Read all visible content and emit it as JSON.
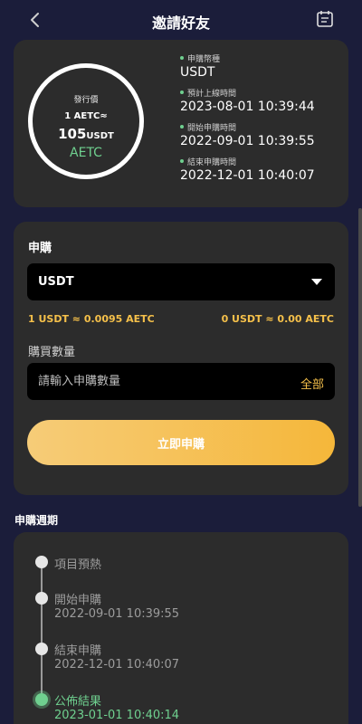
{
  "header": {
    "title": "邀請好友",
    "back_icon": "back-arrow-icon",
    "calendar_icon": "calendar-icon"
  },
  "price_card": {
    "ring_label": "發行價",
    "ring_line1": "1 AETC≈",
    "ring_value": "105",
    "ring_unit": "USDT",
    "ring_token": "AETC",
    "items": [
      {
        "label": "申購幣種",
        "value": "USDT"
      },
      {
        "label": "預計上線時間",
        "value": "2023-08-01 10:39:44"
      },
      {
        "label": "開始申購時間",
        "value": "2022-09-01 10:39:55"
      },
      {
        "label": "結束申購時間",
        "value": "2022-12-01 10:40:07"
      }
    ]
  },
  "subscribe": {
    "title": "申購",
    "currency_selected": "USDT",
    "rate_left": "1 USDT ≈ 0.0095 AETC",
    "rate_right": "0 USDT ≈ 0.00 AETC",
    "qty_label": "購買數量",
    "qty_placeholder": "請輸入申購數量",
    "qty_value": "",
    "all_label": "全部",
    "buy_label": "立即申購"
  },
  "period": {
    "title": "申購週期",
    "steps": [
      {
        "name": "項目預熱",
        "time": ""
      },
      {
        "name": "開始申購",
        "time": "2022-09-01 10:39:55"
      },
      {
        "name": "結束申購",
        "time": "2022-12-01 10:40:07"
      },
      {
        "name": "公佈結果",
        "time": "2023-01-01 10:40:14"
      }
    ]
  },
  "colors": {
    "background": "#1b1d3a",
    "card": "#2c2c2c",
    "accent_gold": "#f5c04a",
    "accent_green": "#6fd08f"
  }
}
